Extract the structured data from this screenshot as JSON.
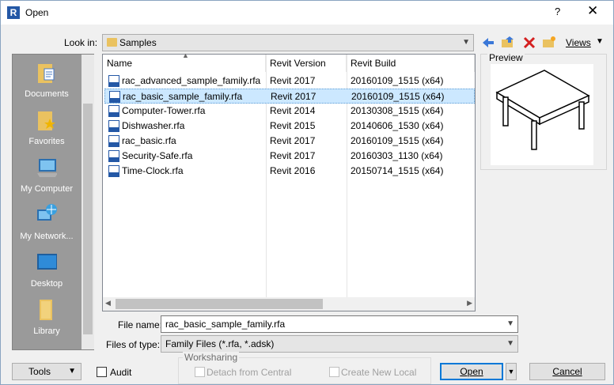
{
  "window": {
    "title": "Open",
    "help_label": "?",
    "close_label": "✕",
    "app_icon_letter": "R"
  },
  "lookin": {
    "label": "Look in:",
    "value": "Samples"
  },
  "toolbar": {
    "icons": [
      "back-icon",
      "up-folder-icon",
      "delete-icon",
      "new-folder-icon"
    ],
    "views_label": "Views"
  },
  "places": [
    {
      "label": "Documents",
      "icon": "documents-icon"
    },
    {
      "label": "Favorites",
      "icon": "favorites-icon"
    },
    {
      "label": "My Computer",
      "icon": "my-computer-icon"
    },
    {
      "label": "My Network...",
      "icon": "my-network-icon"
    },
    {
      "label": "Desktop",
      "icon": "desktop-icon"
    },
    {
      "label": "Library",
      "icon": "library-icon"
    }
  ],
  "columns": [
    "Name",
    "Revit Version",
    "Revit Build"
  ],
  "files": [
    {
      "name": "rac_advanced_sample_family.rfa",
      "version": "Revit 2017",
      "build": "20160109_1515 (x64)",
      "selected": false
    },
    {
      "name": "rac_basic_sample_family.rfa",
      "version": "Revit 2017",
      "build": "20160109_1515 (x64)",
      "selected": true
    },
    {
      "name": "Computer-Tower.rfa",
      "version": "Revit 2014",
      "build": "20130308_1515 (x64)",
      "selected": false
    },
    {
      "name": "Dishwasher.rfa",
      "version": "Revit 2015",
      "build": "20140606_1530 (x64)",
      "selected": false
    },
    {
      "name": "rac_basic.rfa",
      "version": "Revit 2017",
      "build": "20160109_1515 (x64)",
      "selected": false
    },
    {
      "name": "Security-Safe.rfa",
      "version": "Revit 2017",
      "build": "20160303_1130 (x64)",
      "selected": false
    },
    {
      "name": "Time-Clock.rfa",
      "version": "Revit 2016",
      "build": "20150714_1515 (x64)",
      "selected": false
    }
  ],
  "preview": {
    "label": "Preview"
  },
  "filename": {
    "label": "File name:",
    "value": "rac_basic_sample_family.rfa"
  },
  "filetype": {
    "label": "Files of type:",
    "value": "Family Files  (*.rfa, *.adsk)"
  },
  "bottom": {
    "tools_label": "Tools",
    "audit_label": "Audit",
    "worksharing_label": "Worksharing",
    "detach_label": "Detach from Central",
    "create_local_label": "Create New Local",
    "open_label": "Open",
    "cancel_label": "Cancel"
  },
  "colors": {
    "selection": "#cce8ff",
    "places_bg": "#9a9a9a",
    "accent": "#0078d7"
  }
}
